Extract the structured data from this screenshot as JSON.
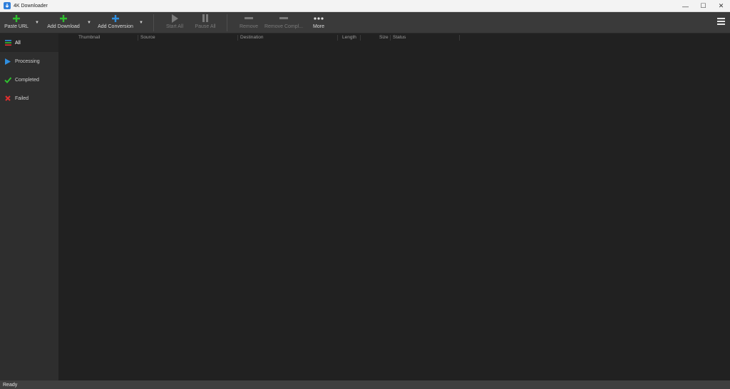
{
  "window": {
    "title": "4K Downloader",
    "controls": {
      "minimize": "—",
      "maximize": "☐",
      "close": "✕"
    }
  },
  "toolbar": {
    "paste_url": {
      "label": "Paste URL",
      "icon": "plus-icon",
      "color": "#2fbf2f"
    },
    "add_download": {
      "label": "Add Download",
      "icon": "plus-icon",
      "color": "#2fbf2f"
    },
    "add_conversion": {
      "label": "Add Conversion",
      "icon": "plus-icon",
      "color": "#2f8fe0"
    },
    "start_all": {
      "label": "Start All",
      "icon": "play-icon"
    },
    "pause_all": {
      "label": "Pause All",
      "icon": "pause-icon"
    },
    "remove": {
      "label": "Remove",
      "icon": "minus-icon"
    },
    "remove_completed": {
      "label": "Remove Compl...",
      "icon": "minus-icon"
    },
    "more": {
      "label": "More",
      "icon": "ellipsis-icon"
    },
    "dropdown_glyph": "▼"
  },
  "sidebar": {
    "items": [
      {
        "label": "All",
        "icon": "list-icon",
        "active": true
      },
      {
        "label": "Processing",
        "icon": "play-icon",
        "color": "#2f8fe0"
      },
      {
        "label": "Completed",
        "icon": "check-icon",
        "color": "#2fbf2f"
      },
      {
        "label": "Failed",
        "icon": "x-icon",
        "color": "#e02f2f"
      }
    ]
  },
  "table": {
    "columns": [
      "Thumbnail",
      "Source",
      "Destination",
      "Length",
      "Size",
      "Status"
    ],
    "rows": []
  },
  "status": {
    "text": "Ready"
  }
}
